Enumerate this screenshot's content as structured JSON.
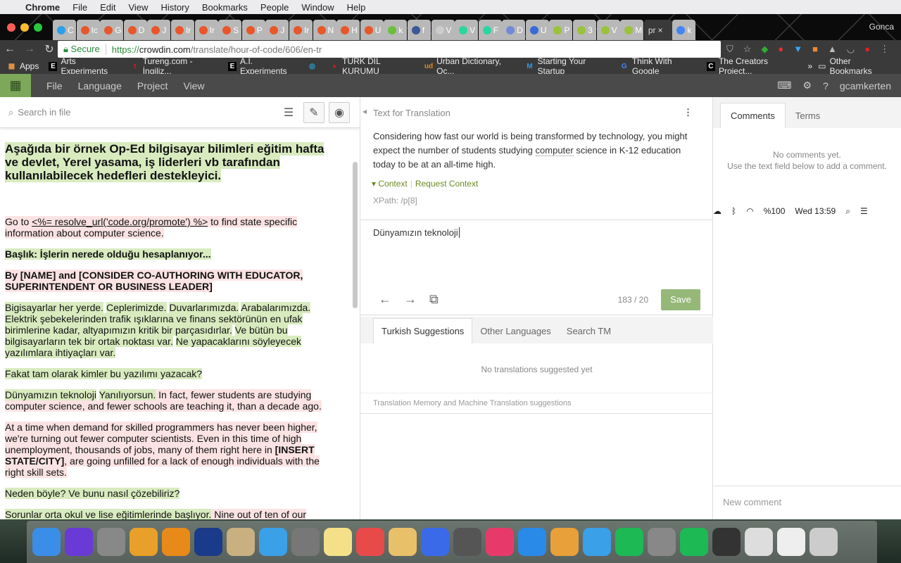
{
  "menubar": {
    "app": "Chrome",
    "items": [
      "File",
      "Edit",
      "View",
      "History",
      "Bookmarks",
      "People",
      "Window",
      "Help"
    ],
    "battery": "%100",
    "clock": "Wed 13:59"
  },
  "tabs": [
    {
      "l": "C",
      "c": "#2aa0e8"
    },
    {
      "l": "Ic",
      "c": "#e8572a"
    },
    {
      "l": "G",
      "c": "#e8572a"
    },
    {
      "l": "D",
      "c": "#e8572a"
    },
    {
      "l": "J",
      "c": "#e8572a"
    },
    {
      "l": "Ir",
      "c": "#e8572a"
    },
    {
      "l": "Ir",
      "c": "#e8572a"
    },
    {
      "l": "S",
      "c": "#e8572a"
    },
    {
      "l": "P",
      "c": "#e8572a"
    },
    {
      "l": "J",
      "c": "#e8572a"
    },
    {
      "l": "Ir",
      "c": "#e8572a"
    },
    {
      "l": "N",
      "c": "#e8572a"
    },
    {
      "l": "H",
      "c": "#e8572a"
    },
    {
      "l": "U",
      "c": "#e8572a"
    },
    {
      "l": "k",
      "c": "#6cbf3a"
    },
    {
      "l": "f",
      "c": "#3b5998"
    },
    {
      "l": "V",
      "c": "#cccccc"
    },
    {
      "l": "V",
      "c": "#2ad6a0"
    },
    {
      "l": "F",
      "c": "#2ad6a0"
    },
    {
      "l": "D",
      "c": "#7289da"
    },
    {
      "l": "U",
      "c": "#3a6ad6"
    },
    {
      "l": "P",
      "c": "#9ac23a"
    },
    {
      "l": "3",
      "c": "#9ac23a"
    },
    {
      "l": "V",
      "c": "#9ac23a"
    },
    {
      "l": "M",
      "c": "#9ac23a"
    }
  ],
  "active_tab": {
    "label": "pr",
    "close": "×"
  },
  "after_tab": {
    "l": "k",
    "c": "#4285f4"
  },
  "profile": "Gonca",
  "address": {
    "secure": "Secure",
    "scheme": "https://",
    "host": "crowdin.com",
    "path": "/translate/hour-of-code/606/en-tr"
  },
  "bookmarks": [
    {
      "icon": "▦",
      "label": "Apps",
      "c": "#e94"
    },
    {
      "icon": "E",
      "label": "Arts Experiments",
      "c": "#000"
    },
    {
      "icon": "t",
      "label": "Tureng.com - İngiliz...",
      "c": "#c22"
    },
    {
      "icon": "E",
      "label": "A.I. Experiments",
      "c": "#000"
    },
    {
      "icon": "◎",
      "label": "",
      "c": "#2ab0e8"
    },
    {
      "icon": "●",
      "label": "TÜRK DİL KURUMU",
      "c": "#b22"
    },
    {
      "icon": "ud",
      "label": "Urban Dictionary, Oc...",
      "c": "#e88a1a"
    },
    {
      "icon": "M",
      "label": "Starting Your Startup",
      "c": "#2a9ae8"
    },
    {
      "icon": "G",
      "label": "Think With Google",
      "c": "#4285f4"
    },
    {
      "icon": "C",
      "label": "The Creators Project...",
      "c": "#111"
    }
  ],
  "bookmarks_more": "»",
  "other_bookmarks": "Other Bookmarks",
  "app_menu": [
    "File",
    "Language",
    "Project",
    "View"
  ],
  "username": "gcamkerten",
  "left": {
    "search_placeholder": "Search in file",
    "paragraphs": [
      {
        "cls": "h1",
        "segs": [
          {
            "t": "Aşağıda bir örnek Op-Ed bilgisayar bilimleri eğitim hafta ve devlet, Yerel yasama, iş liderleri vb tarafından kullanılabilecek hedefleri destekleyici.",
            "s": "tr"
          }
        ]
      },
      {
        "cls": "",
        "segs": [
          {
            "t": "Go to ",
            "s": "un"
          },
          {
            "t": "<%= resolve_url('code.org/promote') %>",
            "s": "un",
            "u": true
          },
          {
            "t": " to find state specific information about computer science.",
            "s": "un"
          }
        ]
      },
      {
        "cls": "b",
        "segs": [
          {
            "t": "Başlık: İşlerin nerede olduğu hesaplanıyor...",
            "s": "tr"
          }
        ]
      },
      {
        "cls": "b",
        "segs": [
          {
            "t": "By [NAME] and [CONSIDER CO-AUTHORING WITH EDUCATOR, SUPERINTENDENT OR BUSINESS LEADER]",
            "s": "un"
          }
        ]
      },
      {
        "cls": "",
        "segs": [
          {
            "t": "Bigisayarlar her yerde.",
            "s": "tr"
          },
          {
            "t": " "
          },
          {
            "t": "Ceplerimizde.",
            "s": "tr"
          },
          {
            "t": " "
          },
          {
            "t": "Duvarlarımızda.",
            "s": "tr"
          },
          {
            "t": " "
          },
          {
            "t": "Arabalarımızda.",
            "s": "tr"
          },
          {
            "t": " "
          },
          {
            "t": "Elektrik şebekelerinden trafik ışıklarına ve finans sektörünün en ufak birimlerine kadar, altyapımızın kritik bir parçasıdırlar.",
            "s": "tr"
          },
          {
            "t": " "
          },
          {
            "t": "Ve bütün bu bilgisayarların tek bir ortak noktası var.",
            "s": "tr"
          },
          {
            "t": " "
          },
          {
            "t": "Ne yapacaklarını söyleyecek yazılımlara ihtiyaçları var.",
            "s": "tr"
          }
        ]
      },
      {
        "cls": "",
        "segs": [
          {
            "t": "Fakat tam olarak kimler bu yazılımı yazacak?",
            "s": "tr"
          }
        ]
      },
      {
        "cls": "",
        "segs": [
          {
            "t": "Dünyamızın teknoloji",
            "s": "tr"
          },
          {
            "t": " "
          },
          {
            "t": "Yanılıyorsun.",
            "s": "tr"
          },
          {
            "t": " In fact, fewer students are studying computer science, and fewer schools are teaching it, than a decade ago.",
            "s": "un"
          }
        ]
      },
      {
        "cls": "",
        "segs": [
          {
            "t": "At a time when demand for skilled programmers has never been higher, we're turning out fewer computer scientists. Even in this time of high unemployment, thousands of jobs, many of them right here in ",
            "s": "un"
          },
          {
            "t": "[INSERT STATE/CITY]",
            "s": "un",
            "b": true
          },
          {
            "t": ", are going unfilled for a lack of enough individuals with the right skill sets.",
            "s": "un"
          }
        ]
      },
      {
        "cls": "",
        "segs": [
          {
            "t": "Neden böyle? Ve bunu nasıl çözebiliriz?",
            "s": "tr"
          }
        ]
      },
      {
        "cls": "",
        "segs": [
          {
            "t": "Sorunlar orta okul ve lise eğitimlerinde başlıyor.",
            "s": "tr"
          },
          {
            "t": " Nine out of ten of our",
            "s": "un"
          }
        ]
      }
    ]
  },
  "middle": {
    "header": "Text for Translation",
    "source_before": "Considering how fast our world is being transformed by technology, you might expect the number of students studying ",
    "source_term": "computer",
    "source_after": " science in K-12 education today to be at an all-time high.",
    "context": "Context",
    "request_context": "Request Context",
    "xpath": "XPath: /p[8]",
    "translation": "Dünyamızın teknoloji",
    "count": "183 / 20",
    "save": "Save",
    "sug_tabs": [
      "Turkish Suggestions",
      "Other Languages",
      "Search TM"
    ],
    "no_suggestions": "No translations suggested yet",
    "tm_note": "Translation Memory and Machine Translation suggestions"
  },
  "right": {
    "tabs": [
      "Comments",
      "Terms"
    ],
    "no_comments": "No comments yet.",
    "hint": "Use the text field below to add a comment.",
    "new_comment_placeholder": "New comment"
  },
  "dock_colors": [
    "#3a8ee8",
    "#6a3ad6",
    "#888",
    "#e8a02a",
    "#e88a1a",
    "#1a3a8a",
    "#c8b080",
    "#3aa0e8",
    "#777",
    "#f5e08a",
    "#e84a4a",
    "#e8c06a",
    "#3a6ae8",
    "#555",
    "#e83a6a",
    "#2a8ae8",
    "#e8a03a",
    "#3aa0e8",
    "#1db954",
    "#888",
    "#1db954",
    "#333",
    "#ddd",
    "#eee",
    "#ccc"
  ],
  "colors": {
    "translated": "#d8ebbf",
    "untranslated": "#fbe3e3",
    "accent": "#7da85a"
  }
}
